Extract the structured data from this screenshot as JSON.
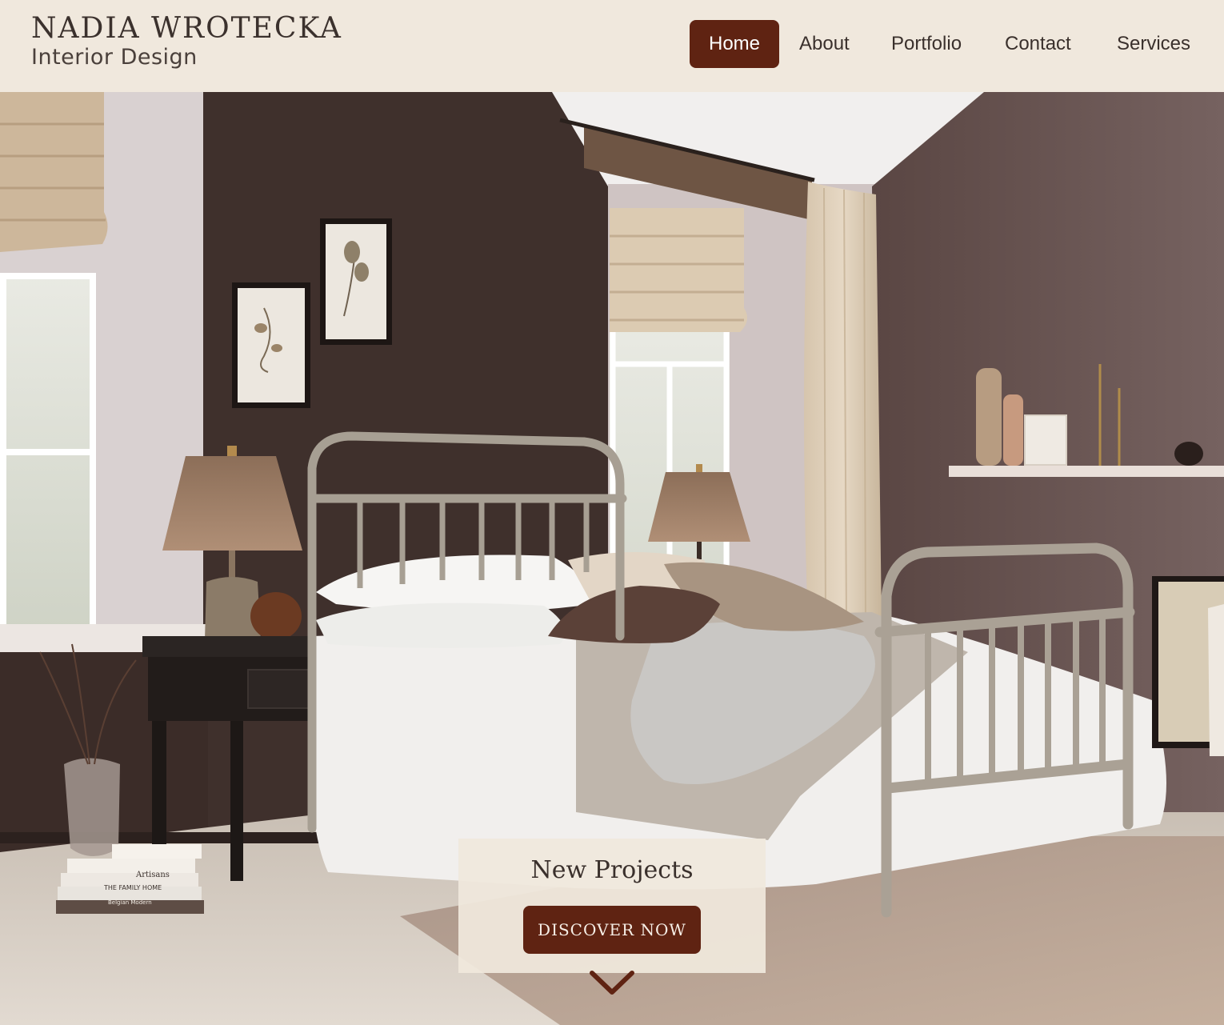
{
  "brand": {
    "name": "NADIA WROTECKA",
    "subtitle": "Interior Design"
  },
  "nav": {
    "items": [
      {
        "label": "Home",
        "active": true
      },
      {
        "label": "About",
        "active": false
      },
      {
        "label": "Portfolio",
        "active": false
      },
      {
        "label": "Contact",
        "active": false
      },
      {
        "label": "Services",
        "active": false
      }
    ]
  },
  "hero": {
    "books": [
      "Artisans",
      "THE FAMILY HOME",
      "Belgian Modern"
    ]
  },
  "cta": {
    "title": "New Projects",
    "button_label": "DISCOVER NOW"
  },
  "icons": {
    "scroll": "chevron-down-icon"
  },
  "colors": {
    "header_bg": "#f0e8dd",
    "accent": "#5f2312",
    "wall_dark": "#3f302c",
    "wall_light": "#6a5552"
  }
}
